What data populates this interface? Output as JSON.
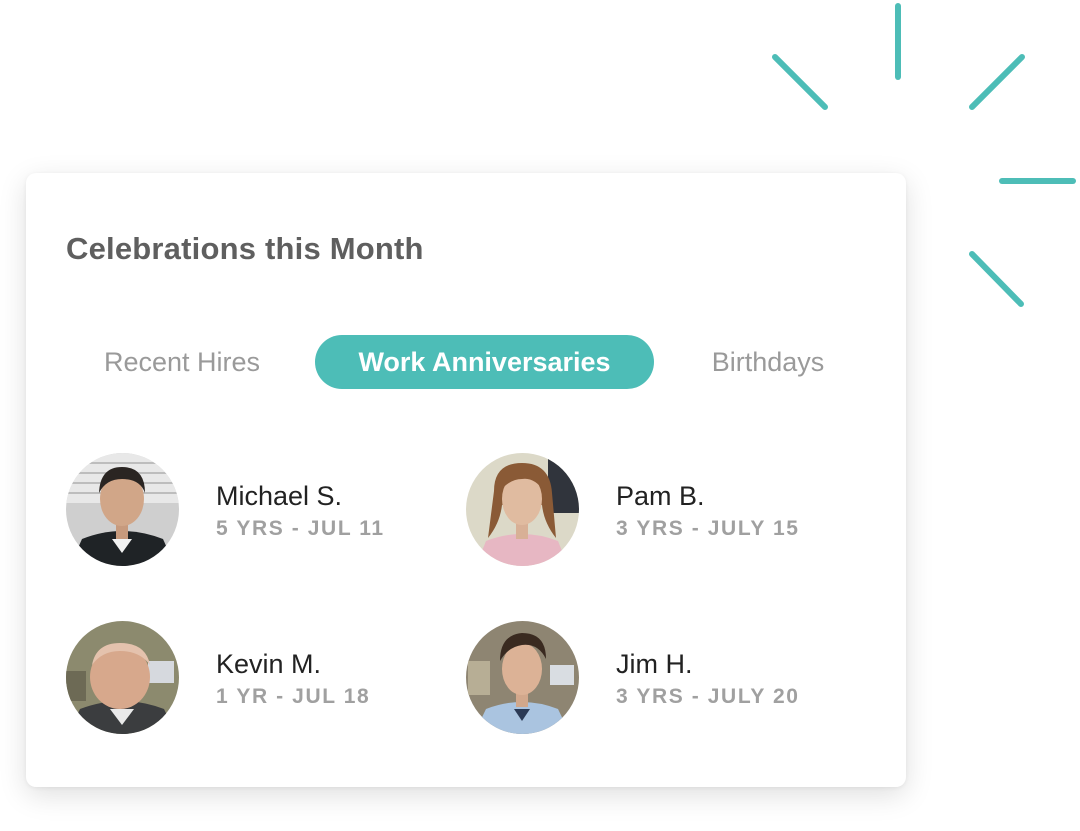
{
  "theme": {
    "accent": "#4dbdb7",
    "title_color": "#5f5f5f",
    "muted": "#a0a0a0"
  },
  "card": {
    "title": "Celebrations this Month",
    "tabs": [
      {
        "label": "Recent Hires",
        "active": false
      },
      {
        "label": "Work Anniversaries",
        "active": true
      },
      {
        "label": "Birthdays",
        "active": false
      }
    ],
    "people": [
      {
        "name": "Michael S.",
        "meta": "5 YRS - JUL 11",
        "icon": "avatar-photo"
      },
      {
        "name": "Pam B.",
        "meta": "3 YRS - JULY 15",
        "icon": "avatar-photo"
      },
      {
        "name": "Kevin M.",
        "meta": "1 YR - JUL 18",
        "icon": "avatar-photo"
      },
      {
        "name": "Jim H.",
        "meta": "3 YRS - JULY 20",
        "icon": "avatar-photo"
      }
    ]
  }
}
